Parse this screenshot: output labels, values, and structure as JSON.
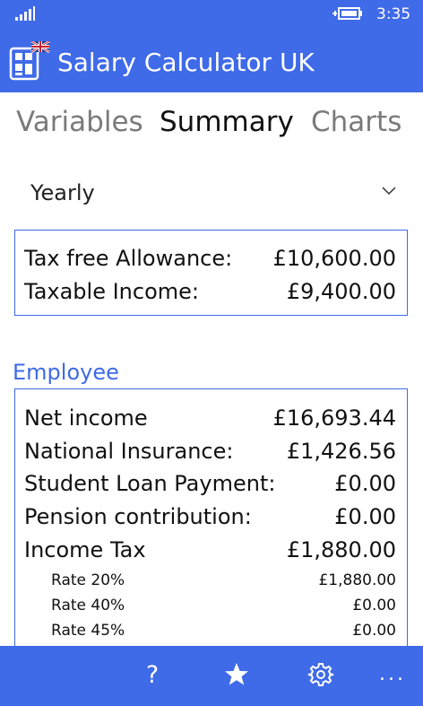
{
  "status_bar": {
    "time": "3:35",
    "signal_icon": "signal-icon",
    "battery_icon": "battery-charging-icon"
  },
  "header": {
    "title": "Salary Calculator UK",
    "logo_icon": "calculator-uk-flag-icon"
  },
  "tabs": [
    {
      "label": "Variables",
      "active": false
    },
    {
      "label": "Summary",
      "active": true
    },
    {
      "label": "Charts",
      "active": false
    }
  ],
  "period": {
    "value": "Yearly",
    "icon": "chevron-down-icon"
  },
  "allowance": {
    "rows": [
      {
        "label": "Tax free Allowance:",
        "value": "£10,600.00"
      },
      {
        "label": "Taxable Income:",
        "value": "£9,400.00"
      }
    ]
  },
  "employee": {
    "title": "Employee",
    "rows": [
      {
        "label": "Net income",
        "value": "£16,693.44"
      },
      {
        "label": "National Insurance:",
        "value": "£1,426.56"
      },
      {
        "label": "Student Loan Payment:",
        "value": "£0.00"
      },
      {
        "label": "Pension contribution:",
        "value": "£0.00"
      },
      {
        "label": "Income Tax",
        "value": "£1,880.00"
      }
    ],
    "rates": [
      {
        "label": "Rate 20%",
        "value": "£1,880.00"
      },
      {
        "label": "Rate 40%",
        "value": "£0.00"
      },
      {
        "label": "Rate 45%",
        "value": "£0.00"
      }
    ]
  },
  "app_bar": {
    "help_label": "?",
    "more_label": "...",
    "icons": [
      "help-icon",
      "star-icon",
      "gear-icon",
      "more-icon"
    ]
  },
  "colors": {
    "accent": "#3F6AE8",
    "text": "#111111",
    "inactive_tab": "#7a7a7a",
    "background": "#ffffff"
  }
}
